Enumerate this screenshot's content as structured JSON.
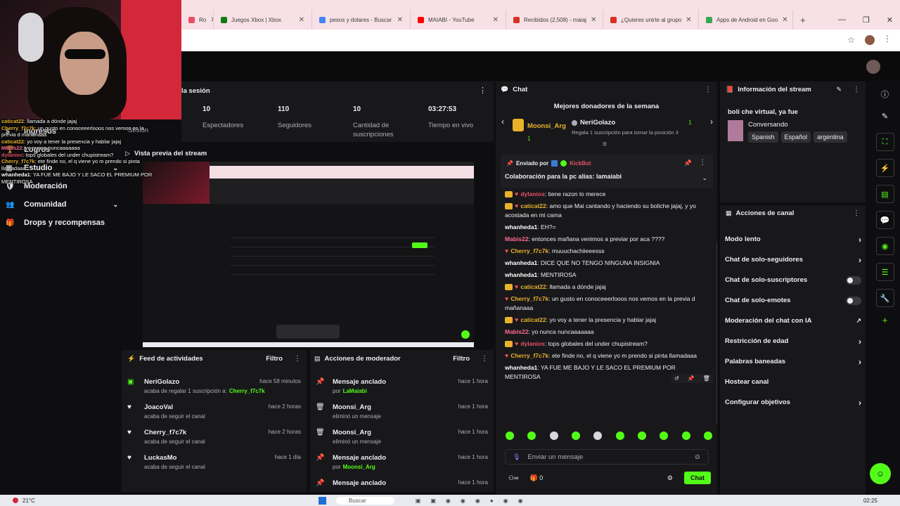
{
  "browser": {
    "tabs": [
      {
        "label": "Ro",
        "color": "#e94f63"
      },
      {
        "label": "Juegos Xbox | Xbox",
        "color": "#107c10"
      },
      {
        "label": "pesos y dolares - Buscar",
        "color": "#4285f4"
      },
      {
        "label": "MAIABI - YouTube",
        "color": "#ff0000"
      },
      {
        "label": "Recibidos (2,508) - maiaj",
        "color": "#d93025"
      },
      {
        "label": "¿Quieres unirte al grupo",
        "color": "#d93025"
      },
      {
        "label": "Apps de Android en Goo",
        "color": "#34a853"
      }
    ],
    "new_tab": "+",
    "win_controls": [
      "—",
      "❐",
      "✕"
    ]
  },
  "dashboard": {
    "session_header": "la sesión",
    "session_label": "Sesión",
    "stats": [
      {
        "value": "10",
        "label": "Espectadores"
      },
      {
        "value": "110",
        "label": "Seguidores"
      },
      {
        "value": "10",
        "label": "Cantidad de suscripciones"
      },
      {
        "value": "03:27:53",
        "label": "Tiempo en vivo"
      }
    ],
    "sidebar": [
      {
        "label": "Ingresos",
        "icon": "dollar-icon"
      },
      {
        "label": "Logros",
        "icon": "trophy-icon"
      },
      {
        "label": "Estudio",
        "icon": "studio-icon"
      },
      {
        "label": "Moderación",
        "icon": "shield-icon"
      },
      {
        "label": "Comunidad",
        "icon": "users-icon"
      },
      {
        "label": "Drops y recompensas",
        "icon": "gift-icon"
      }
    ],
    "preview_title": "Vista previa del stream",
    "activity": {
      "title": "Feed de actividades",
      "filter": "Filtro",
      "items": [
        {
          "name": "NeriGolazo",
          "text": "acaba de regalar 1 suscripción a:",
          "target": "Cherry_f7c7k",
          "time": "hace 58 minutos",
          "icon": "gift-icon"
        },
        {
          "name": "JoacoVal",
          "text": "acaba de seguir el canal",
          "target": "",
          "time": "hace 2 horas",
          "icon": "heart-icon"
        },
        {
          "name": "Cherry_f7c7k",
          "text": "acaba de seguir el canal",
          "target": "",
          "time": "hace 2 horas",
          "icon": "heart-icon"
        },
        {
          "name": "LuckasMo",
          "text": "acaba de seguir el canal",
          "target": "",
          "time": "hace 1 día",
          "icon": "heart-icon"
        }
      ]
    },
    "modactions": {
      "title": "Acciones de moderador",
      "filter": "Filtro",
      "items": [
        {
          "name": "Mensaje anclado",
          "text": "por",
          "target": "LaMaiabi",
          "time": "hace 1 hora",
          "icon": "pin-icon"
        },
        {
          "name": "Moonsi_Arg",
          "text": "eliminó un mensaje",
          "target": "",
          "time": "hace 1 hora",
          "icon": "trash-icon"
        },
        {
          "name": "Moonsi_Arg",
          "text": "eliminó un mensaje",
          "target": "",
          "time": "hace 1 hora",
          "icon": "trash-icon"
        },
        {
          "name": "Mensaje anclado",
          "text": "por",
          "target": "Moonsi_Arg",
          "time": "hace 1 hora",
          "icon": "pin-icon"
        },
        {
          "name": "Mensaje anclado",
          "text": "",
          "target": "",
          "time": "hace 1 hora",
          "icon": "pin-icon"
        }
      ]
    }
  },
  "chat": {
    "title": "Chat",
    "donors_title": "Mejores donadores de la semana",
    "donor_1": {
      "name": "Moonsi_Arg",
      "count": "1"
    },
    "donor_2": {
      "name": "NeriGolazo",
      "count": "1",
      "sub": "Regala 1 suscripción para tomar la posición 3"
    },
    "pinned": {
      "by_label": "Enviado por",
      "by_user": "KickBot",
      "text": "Colaboración para la pc alias: lamaiabi"
    },
    "messages": [
      {
        "user": "dylanios",
        "color": "#e94f63",
        "text": "tiene razon lo merece",
        "crown": true,
        "heart": true
      },
      {
        "user": "caticat22",
        "color": "#e8b22b",
        "text": "amo que Mai cantando y haciendo su boliche jajaj, y yo acostada en mi cama",
        "crown": true,
        "heart": true
      },
      {
        "user": "whanheda1",
        "color": "#ffffff",
        "text": "EH?=",
        "crown": false,
        "heart": false
      },
      {
        "user": "Mabis22",
        "color": "#ff6a8e",
        "text": "entonces mañana venimos a previar por aca ????",
        "crown": false,
        "heart": false
      },
      {
        "user": "Cherry_f7c7k",
        "color": "#e8b22b",
        "text": "muuuchachiieeesss",
        "crown": false,
        "heart": true
      },
      {
        "user": "whanheda1",
        "color": "#ffffff",
        "text": "DICE QUE NO TENGO NINGUNA INSIGNIA",
        "crown": false,
        "heart": false
      },
      {
        "user": "whanheda1",
        "color": "#ffffff",
        "text": "MENTIROSA",
        "crown": false,
        "heart": false
      },
      {
        "user": "caticat22",
        "color": "#e8b22b",
        "text": "llamada a dónde jajaj",
        "crown": true,
        "heart": true
      },
      {
        "user": "Cherry_f7c7k",
        "color": "#e8b22b",
        "text": "un gusto en conoceeerlooos nos vemos en la previa d mañanaaa",
        "crown": false,
        "heart": true
      },
      {
        "user": "caticat22",
        "color": "#e8b22b",
        "text": "yo voy a tener la presencia y hablar jajaj",
        "crown": true,
        "heart": true
      },
      {
        "user": "Mabis22",
        "color": "#ff6a8e",
        "text": "yo nunca nuncaaaaaaa",
        "crown": false,
        "heart": false
      },
      {
        "user": "dylanios",
        "color": "#e94f63",
        "text": "tops globales del under chupistream?",
        "crown": true,
        "heart": true
      },
      {
        "user": "Cherry_f7c7k",
        "color": "#e8b22b",
        "text": "ete finde no, el q viene yo m prendo si pinta llamadaaa",
        "crown": false,
        "heart": true
      },
      {
        "user": "whanheda1",
        "color": "#ffffff",
        "text": "YA FUE ME BAJO Y LE SACO EL PREMIUM POR MENTIROSA",
        "crown": false,
        "heart": false
      }
    ],
    "input_placeholder": "Enviar un mensaje",
    "points": "0",
    "send_label": "Chat"
  },
  "info": {
    "title": "Información del stream",
    "stream_title": "boli che virtual, ya fue",
    "category": "Conversando",
    "tags": [
      "Spanish",
      "Español",
      "argentina"
    ]
  },
  "actions": {
    "title": "Acciones de canal",
    "items": [
      {
        "label": "Modo lento",
        "type": "chevron"
      },
      {
        "label": "Chat de solo-seguidores",
        "type": "chevron"
      },
      {
        "label": "Chat de solo-suscriptores",
        "type": "toggle"
      },
      {
        "label": "Chat de solo-emotes",
        "type": "toggle"
      },
      {
        "label": "Moderación del chat con IA",
        "type": "external"
      },
      {
        "label": "Restricción de edad",
        "type": "chevron"
      },
      {
        "label": "Palabras baneadas",
        "type": "chevron"
      },
      {
        "label": "Hostear canal",
        "type": "none"
      },
      {
        "label": "Configurar objetivos",
        "type": "chevron"
      }
    ]
  },
  "overlay_chat": [
    {
      "user": "caticat22",
      "color": "#e8b22b",
      "text": "llamada a dónde jajaj"
    },
    {
      "user": "Cherry_f7c7k",
      "color": "#e8b22b",
      "text": "un gusto en conoceeerlooos nos vemos en la"
    },
    {
      "user": "",
      "color": "#ffffff",
      "text": "previa d mañanaaa"
    },
    {
      "user": "caticat22",
      "color": "#e8b22b",
      "text": "yo voy a tener la presencia y hablar jajaj"
    },
    {
      "user": "Mabis22",
      "color": "#ff6a8e",
      "text": "yo nunca nuncaaaaaaa"
    },
    {
      "user": "dylanios",
      "color": "#e94f63",
      "text": "tops globales del under chupistream?"
    },
    {
      "user": "Cherry_f7c7k",
      "color": "#e8b22b",
      "text": "ete finde no, el q viene yo m prendo si pinta"
    },
    {
      "user": "",
      "color": "#ffffff",
      "text": "llamadaaa"
    },
    {
      "user": "whanheda1",
      "color": "#ffffff",
      "text": "YA FUE ME BAJO Y LE SACO EL PREMIUM POR"
    },
    {
      "user": "",
      "color": "#ffffff",
      "text": "MENTIROSA"
    }
  ],
  "taskbar": {
    "weather": "21°C",
    "search": "Buscar",
    "time": "02:25"
  },
  "colors": {
    "accent": "#53fc18",
    "bg": "#0e0e10",
    "panel": "#18181b"
  }
}
